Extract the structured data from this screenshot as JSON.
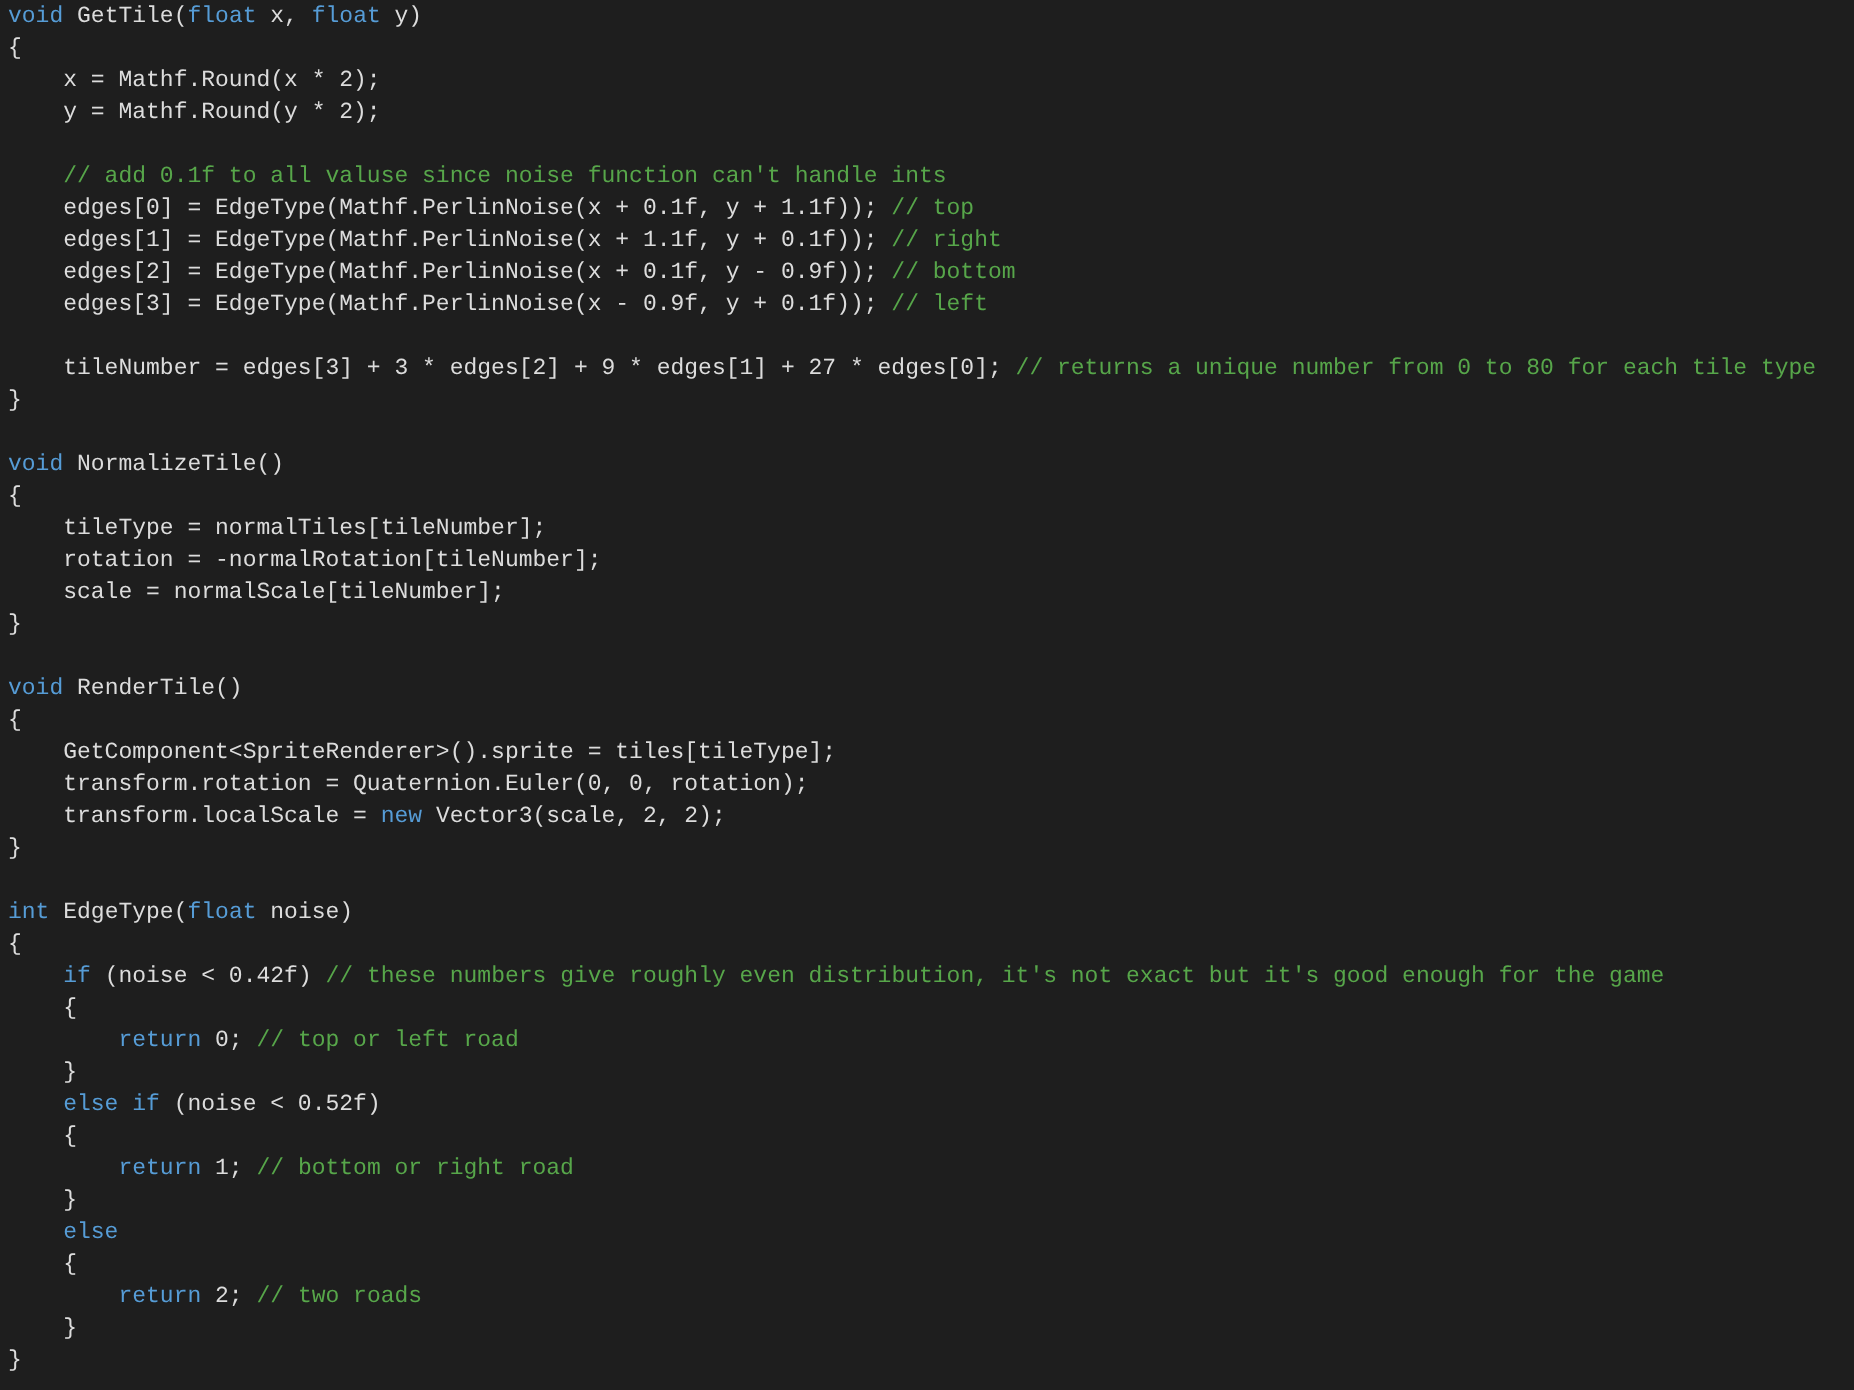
{
  "editor": {
    "lines": [
      {
        "kind": "code",
        "segments": [
          {
            "kind": "keyword",
            "text": "void"
          },
          {
            "kind": "plain",
            "text": " GetTile("
          },
          {
            "kind": "keyword",
            "text": "float"
          },
          {
            "kind": "plain",
            "text": " x, "
          },
          {
            "kind": "keyword",
            "text": "float"
          },
          {
            "kind": "plain",
            "text": " y)"
          }
        ]
      },
      {
        "kind": "code",
        "segments": [
          {
            "kind": "plain",
            "text": "{"
          }
        ]
      },
      {
        "kind": "code",
        "segments": [
          {
            "kind": "plain",
            "text": "    x = Mathf.Round(x * 2);"
          }
        ]
      },
      {
        "kind": "code",
        "segments": [
          {
            "kind": "plain",
            "text": "    y = Mathf.Round(y * 2);"
          }
        ]
      },
      {
        "kind": "blank"
      },
      {
        "kind": "code",
        "segments": [
          {
            "kind": "comment",
            "text": "    // add 0.1f to all valuse since noise function can't handle ints"
          }
        ]
      },
      {
        "kind": "code",
        "segments": [
          {
            "kind": "plain",
            "text": "    edges[0] = EdgeType(Mathf.PerlinNoise(x + 0.1f, y + 1.1f)); "
          },
          {
            "kind": "comment",
            "text": "// top"
          }
        ]
      },
      {
        "kind": "code",
        "segments": [
          {
            "kind": "plain",
            "text": "    edges[1] = EdgeType(Mathf.PerlinNoise(x + 1.1f, y + 0.1f)); "
          },
          {
            "kind": "comment",
            "text": "// right"
          }
        ]
      },
      {
        "kind": "code",
        "segments": [
          {
            "kind": "plain",
            "text": "    edges[2] = EdgeType(Mathf.PerlinNoise(x + 0.1f, y - 0.9f)); "
          },
          {
            "kind": "comment",
            "text": "// bottom"
          }
        ]
      },
      {
        "kind": "code",
        "segments": [
          {
            "kind": "plain",
            "text": "    edges[3] = EdgeType(Mathf.PerlinNoise(x - 0.9f, y + 0.1f)); "
          },
          {
            "kind": "comment",
            "text": "// left"
          }
        ]
      },
      {
        "kind": "blank"
      },
      {
        "kind": "code",
        "segments": [
          {
            "kind": "plain",
            "text": "    tileNumber = edges[3] + 3 * edges[2] + 9 * edges[1] + 27 * edges[0]; "
          },
          {
            "kind": "comment",
            "text": "// returns a unique number from 0 to 80 for each tile type"
          }
        ]
      },
      {
        "kind": "code",
        "segments": [
          {
            "kind": "plain",
            "text": "}"
          }
        ]
      },
      {
        "kind": "blank"
      },
      {
        "kind": "code",
        "segments": [
          {
            "kind": "keyword",
            "text": "void"
          },
          {
            "kind": "plain",
            "text": " NormalizeTile()"
          }
        ]
      },
      {
        "kind": "code",
        "segments": [
          {
            "kind": "plain",
            "text": "{"
          }
        ]
      },
      {
        "kind": "code",
        "segments": [
          {
            "kind": "plain",
            "text": "    tileType = normalTiles[tileNumber];"
          }
        ]
      },
      {
        "kind": "code",
        "segments": [
          {
            "kind": "plain",
            "text": "    rotation = -normalRotation[tileNumber];"
          }
        ]
      },
      {
        "kind": "code",
        "segments": [
          {
            "kind": "plain",
            "text": "    scale = normalScale[tileNumber];"
          }
        ]
      },
      {
        "kind": "code",
        "segments": [
          {
            "kind": "plain",
            "text": "}"
          }
        ]
      },
      {
        "kind": "blank"
      },
      {
        "kind": "code",
        "segments": [
          {
            "kind": "keyword",
            "text": "void"
          },
          {
            "kind": "plain",
            "text": " RenderTile()"
          }
        ]
      },
      {
        "kind": "code",
        "segments": [
          {
            "kind": "plain",
            "text": "{"
          }
        ]
      },
      {
        "kind": "code",
        "segments": [
          {
            "kind": "plain",
            "text": "    GetComponent<SpriteRenderer>().sprite = tiles[tileType];"
          }
        ]
      },
      {
        "kind": "code",
        "segments": [
          {
            "kind": "plain",
            "text": "    transform.rotation = Quaternion.Euler(0, 0, rotation);"
          }
        ]
      },
      {
        "kind": "code",
        "segments": [
          {
            "kind": "plain",
            "text": "    transform.localScale = "
          },
          {
            "kind": "keyword",
            "text": "new"
          },
          {
            "kind": "plain",
            "text": " Vector3(scale, 2, 2);"
          }
        ]
      },
      {
        "kind": "code",
        "segments": [
          {
            "kind": "plain",
            "text": "}"
          }
        ]
      },
      {
        "kind": "blank"
      },
      {
        "kind": "code",
        "segments": [
          {
            "kind": "keyword",
            "text": "int"
          },
          {
            "kind": "plain",
            "text": " EdgeType("
          },
          {
            "kind": "keyword",
            "text": "float"
          },
          {
            "kind": "plain",
            "text": " noise)"
          }
        ]
      },
      {
        "kind": "code",
        "segments": [
          {
            "kind": "plain",
            "text": "{"
          }
        ]
      },
      {
        "kind": "code",
        "segments": [
          {
            "kind": "keyword",
            "text": "    if"
          },
          {
            "kind": "plain",
            "text": " (noise < 0.42f) "
          },
          {
            "kind": "comment",
            "text": "// these numbers give roughly even distribution, it's not exact but it's good enough for the game"
          }
        ]
      },
      {
        "kind": "code",
        "segments": [
          {
            "kind": "plain",
            "text": "    {"
          }
        ]
      },
      {
        "kind": "code",
        "segments": [
          {
            "kind": "keyword",
            "text": "        return"
          },
          {
            "kind": "plain",
            "text": " 0; "
          },
          {
            "kind": "comment",
            "text": "// top or left road"
          }
        ]
      },
      {
        "kind": "code",
        "segments": [
          {
            "kind": "plain",
            "text": "    }"
          }
        ]
      },
      {
        "kind": "code",
        "segments": [
          {
            "kind": "keyword",
            "text": "    else if"
          },
          {
            "kind": "plain",
            "text": " (noise < 0.52f)"
          }
        ]
      },
      {
        "kind": "code",
        "segments": [
          {
            "kind": "plain",
            "text": "    {"
          }
        ]
      },
      {
        "kind": "code",
        "segments": [
          {
            "kind": "keyword",
            "text": "        return"
          },
          {
            "kind": "plain",
            "text": " 1; "
          },
          {
            "kind": "comment",
            "text": "// bottom or right road"
          }
        ]
      },
      {
        "kind": "code",
        "segments": [
          {
            "kind": "plain",
            "text": "    }"
          }
        ]
      },
      {
        "kind": "code",
        "segments": [
          {
            "kind": "keyword",
            "text": "    else"
          }
        ]
      },
      {
        "kind": "code",
        "segments": [
          {
            "kind": "plain",
            "text": "    {"
          }
        ]
      },
      {
        "kind": "code",
        "segments": [
          {
            "kind": "keyword",
            "text": "        return"
          },
          {
            "kind": "plain",
            "text": " 2; "
          },
          {
            "kind": "comment",
            "text": "// two roads"
          }
        ]
      },
      {
        "kind": "code",
        "segments": [
          {
            "kind": "plain",
            "text": "    }"
          }
        ]
      },
      {
        "kind": "code",
        "segments": [
          {
            "kind": "plain",
            "text": "}"
          }
        ]
      }
    ]
  }
}
